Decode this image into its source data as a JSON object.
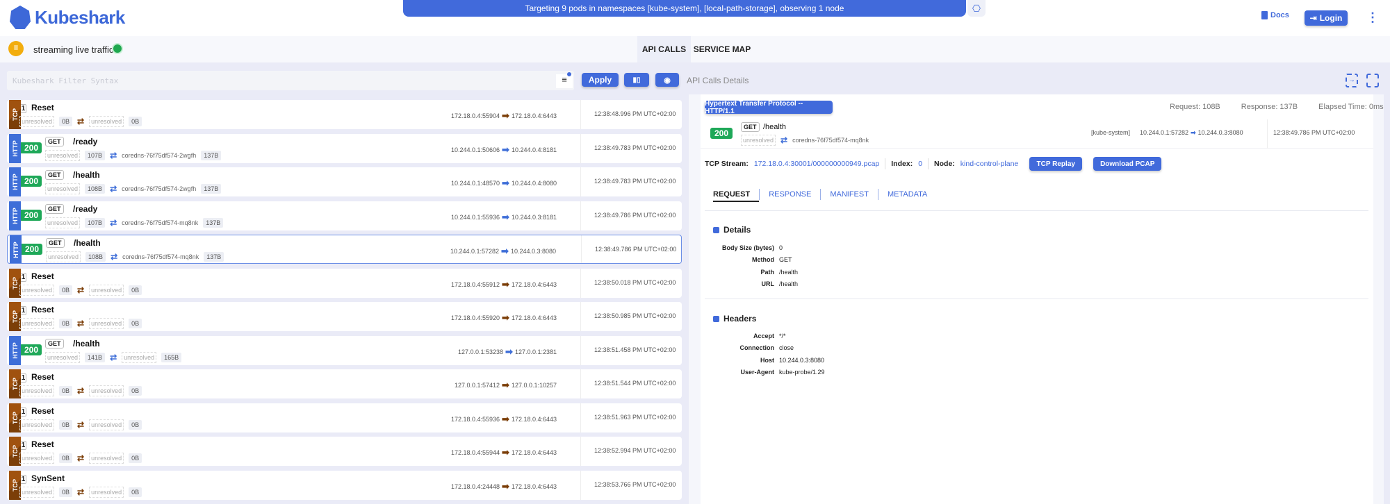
{
  "app": {
    "name": "Kubeshark"
  },
  "banner": {
    "text": "Targeting 9 pods in namespaces [kube-system], [local-path-storage], observing 1 node"
  },
  "header": {
    "docs": "Docs",
    "login": "Login"
  },
  "toolbar": {
    "status": "streaming live traffic",
    "tabs": [
      "API CALLS",
      "SERVICE MAP"
    ]
  },
  "filter": {
    "placeholder": "Kubeshark Filter Syntax",
    "apply": "Apply",
    "details_label": "API Calls Details"
  },
  "colors": {
    "brand": "#416adb",
    "tcp": "#a0520f",
    "http": "#3e6ed8",
    "ok": "#1ea858"
  },
  "entries": [
    {
      "proto": "TCP",
      "status": "1",
      "name": "Reset",
      "src_name": "unresolved",
      "req": "0B",
      "dst_name": "unresolved",
      "resp": "0B",
      "src": "172.18.0.4:55904",
      "dst": "172.18.0.4:6443",
      "time": "12:38:48.996 PM UTC+02:00"
    },
    {
      "proto": "HTTP",
      "status": "200",
      "method": "GET",
      "name": "/ready",
      "src_name": "unresolved",
      "req": "107B",
      "dst_name": "coredns-76f75df574-2wgfh",
      "resp": "137B",
      "src": "10.244.0.1:50606",
      "dst": "10.244.0.4:8181",
      "time": "12:38:49.783 PM UTC+02:00"
    },
    {
      "proto": "HTTP",
      "status": "200",
      "method": "GET",
      "name": "/health",
      "src_name": "unresolved",
      "req": "108B",
      "dst_name": "coredns-76f75df574-2wgfh",
      "resp": "137B",
      "src": "10.244.0.1:48570",
      "dst": "10.244.0.4:8080",
      "time": "12:38:49.783 PM UTC+02:00"
    },
    {
      "proto": "HTTP",
      "status": "200",
      "method": "GET",
      "name": "/ready",
      "src_name": "unresolved",
      "req": "107B",
      "dst_name": "coredns-76f75df574-mq8nk",
      "resp": "137B",
      "src": "10.244.0.1:55936",
      "dst": "10.244.0.3:8181",
      "time": "12:38:49.786 PM UTC+02:00"
    },
    {
      "proto": "HTTP",
      "status": "200",
      "method": "GET",
      "name": "/health",
      "src_name": "unresolved",
      "req": "108B",
      "dst_name": "coredns-76f75df574-mq8nk",
      "resp": "137B",
      "src": "10.244.0.1:57282",
      "dst": "10.244.0.3:8080",
      "time": "12:38:49.786 PM UTC+02:00",
      "selected": true
    },
    {
      "proto": "TCP",
      "status": "1",
      "name": "Reset",
      "src_name": "unresolved",
      "req": "0B",
      "dst_name": "unresolved",
      "resp": "0B",
      "src": "172.18.0.4:55912",
      "dst": "172.18.0.4:6443",
      "time": "12:38:50.018 PM UTC+02:00"
    },
    {
      "proto": "TCP",
      "status": "1",
      "name": "Reset",
      "src_name": "unresolved",
      "req": "0B",
      "dst_name": "unresolved",
      "resp": "0B",
      "src": "172.18.0.4:55920",
      "dst": "172.18.0.4:6443",
      "time": "12:38:50.985 PM UTC+02:00"
    },
    {
      "proto": "HTTP",
      "status": "200",
      "method": "GET",
      "name": "/health",
      "src_name": "unresolved",
      "req": "141B",
      "dst_name": "unresolved",
      "resp": "165B",
      "src": "127.0.0.1:53238",
      "dst": "127.0.0.1:2381",
      "time": "12:38:51.458 PM UTC+02:00"
    },
    {
      "proto": "TCP",
      "status": "1",
      "name": "Reset",
      "src_name": "unresolved",
      "req": "0B",
      "dst_name": "unresolved",
      "resp": "0B",
      "src": "127.0.0.1:57412",
      "dst": "127.0.0.1:10257",
      "time": "12:38:51.544 PM UTC+02:00"
    },
    {
      "proto": "TCP",
      "status": "1",
      "name": "Reset",
      "src_name": "unresolved",
      "req": "0B",
      "dst_name": "unresolved",
      "resp": "0B",
      "src": "172.18.0.4:55936",
      "dst": "172.18.0.4:6443",
      "time": "12:38:51.963 PM UTC+02:00"
    },
    {
      "proto": "TCP",
      "status": "1",
      "name": "Reset",
      "src_name": "unresolved",
      "req": "0B",
      "dst_name": "unresolved",
      "resp": "0B",
      "src": "172.18.0.4:55944",
      "dst": "172.18.0.4:6443",
      "time": "12:38:52.994 PM UTC+02:00"
    },
    {
      "proto": "TCP",
      "status": "1",
      "name": "SynSent",
      "src_name": "unresolved",
      "req": "0B",
      "dst_name": "unresolved",
      "resp": "0B",
      "src": "172.18.0.4:24448",
      "dst": "172.18.0.4:6443",
      "time": "12:38:53.766 PM UTC+02:00"
    }
  ],
  "detail": {
    "protocol": "Hypertext Transfer Protocol -- HTTP/1.1",
    "request_size": "Request: 108B",
    "response_size": "Response: 137B",
    "elapsed": "Elapsed Time: 0ms",
    "status": "200",
    "method": "GET",
    "path": "/health",
    "src_name": "unresolved",
    "dst_name": "coredns-76f75df574-mq8nk",
    "namespace": "[kube-system]",
    "src": "10.244.0.1:57282",
    "dst": "10.244.0.3:8080",
    "time": "12:38:49.786 PM UTC+02:00",
    "stream_label": "TCP Stream:",
    "stream": "172.18.0.4:30001/000000000949.pcap",
    "index_label": "Index:",
    "index": "0",
    "node_label": "Node:",
    "node": "kind-control-plane",
    "tcp_replay": "TCP Replay",
    "download_pcap": "Download PCAP",
    "tabs": [
      "REQUEST",
      "RESPONSE",
      "MANIFEST",
      "METADATA"
    ],
    "details_title": "Details",
    "details": [
      {
        "k": "Body Size (bytes)",
        "v": "0"
      },
      {
        "k": "Method",
        "v": "GET"
      },
      {
        "k": "Path",
        "v": "/health"
      },
      {
        "k": "URL",
        "v": "/health"
      }
    ],
    "headers_title": "Headers",
    "headers": [
      {
        "k": "Accept",
        "v": "*/*"
      },
      {
        "k": "Connection",
        "v": "close"
      },
      {
        "k": "Host",
        "v": "10.244.0.3:8080"
      },
      {
        "k": "User-Agent",
        "v": "kube-probe/1.29"
      }
    ]
  }
}
